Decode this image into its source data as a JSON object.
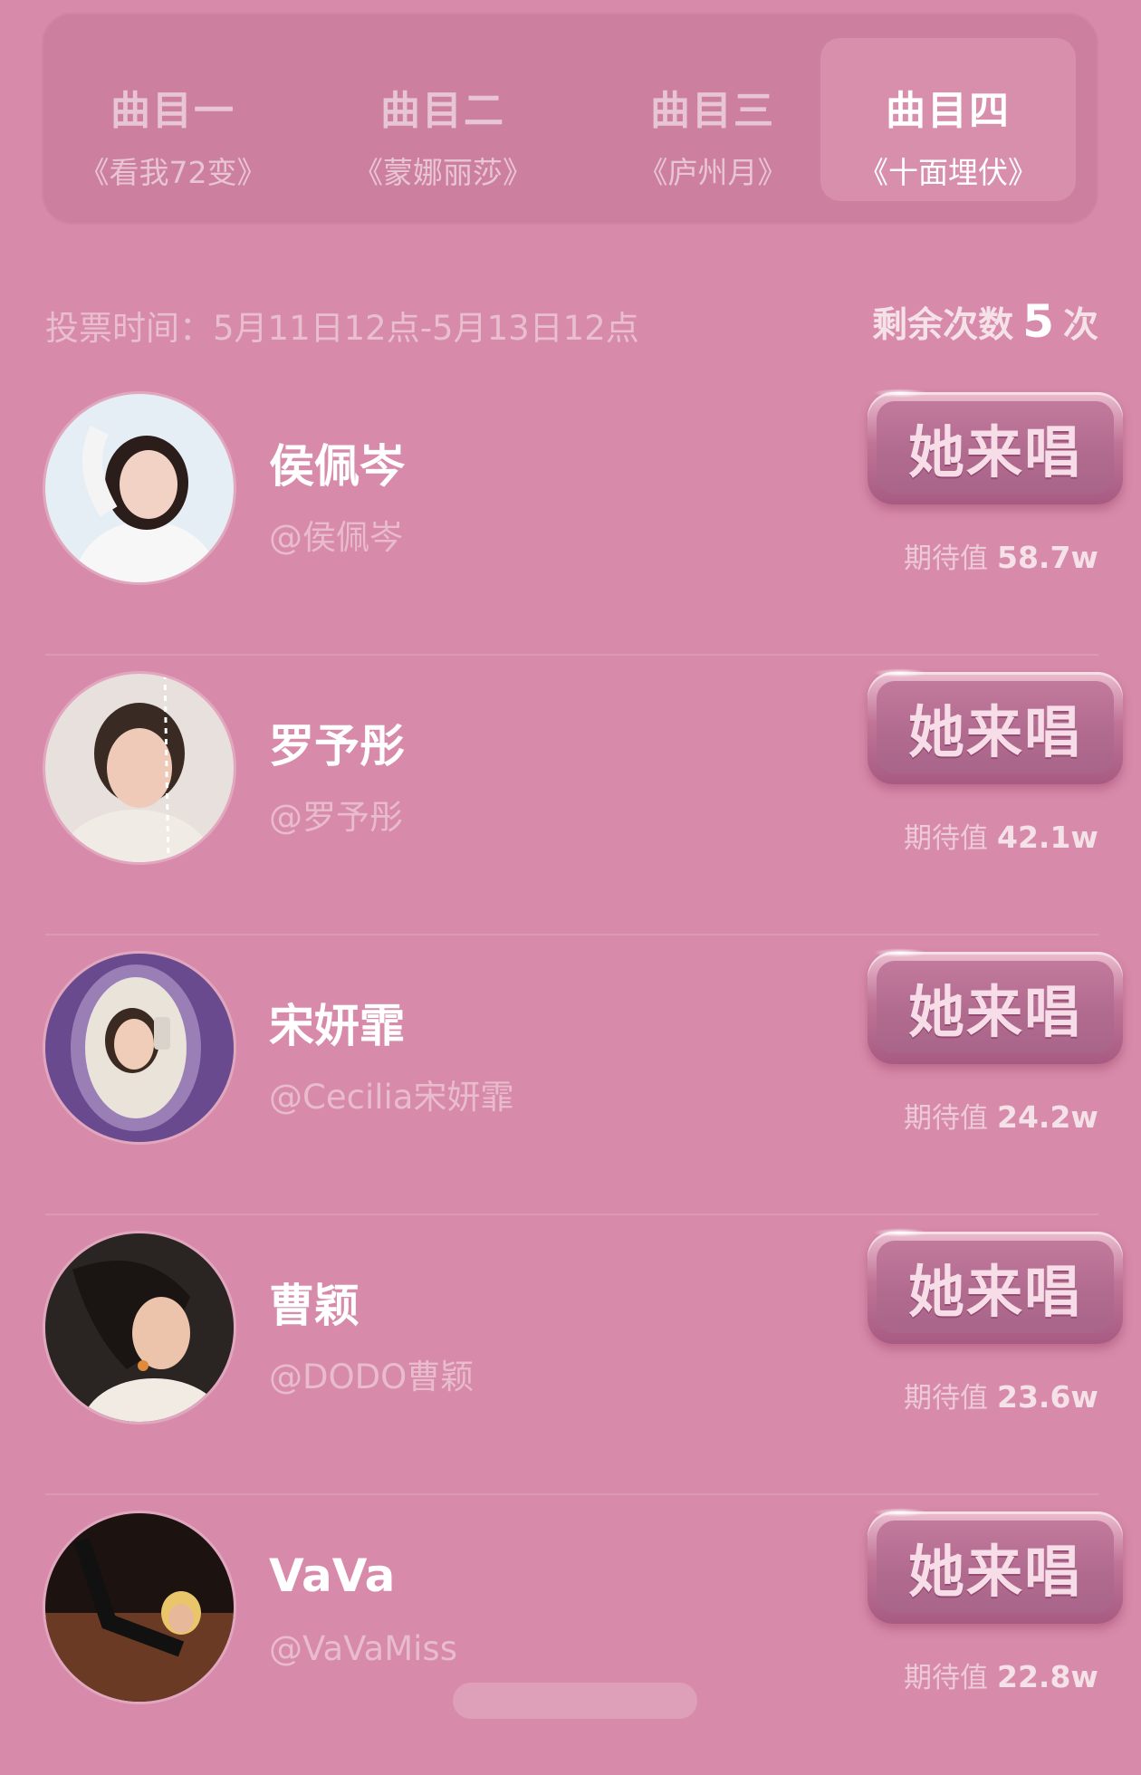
{
  "tabs": [
    {
      "num": "曲目一",
      "song": "《看我72变》",
      "active": false
    },
    {
      "num": "曲目二",
      "song": "《蒙娜丽莎》",
      "active": false
    },
    {
      "num": "曲目三",
      "song": "《庐州月》",
      "active": false
    },
    {
      "num": "曲目四",
      "song": "《十面埋伏》",
      "active": true
    }
  ],
  "info": {
    "vote_time": "投票时间：5月11日12点-5月13日12点",
    "remain_prefix": "剩余次数",
    "remain_count": "5",
    "remain_suffix": "次"
  },
  "sing_button_label": "她来唱",
  "expect_label": "期待值",
  "candidates": [
    {
      "name": "侯佩岑",
      "handle": "@侯佩岑",
      "expect": "58.7w"
    },
    {
      "name": "罗予彤",
      "handle": "@罗予彤",
      "expect": "42.1w"
    },
    {
      "name": "宋妍霏",
      "handle": "@Cecilia宋妍霏",
      "expect": "24.2w"
    },
    {
      "name": "曹颖",
      "handle": "@DODO曹颖",
      "expect": "23.6w"
    },
    {
      "name": "VaVa",
      "handle": "@VaVaMiss",
      "expect": "22.8w"
    }
  ],
  "colors": {
    "background": "#d78aa9",
    "tab_panel": "#cd7f9f",
    "button": "#b06a8e"
  }
}
